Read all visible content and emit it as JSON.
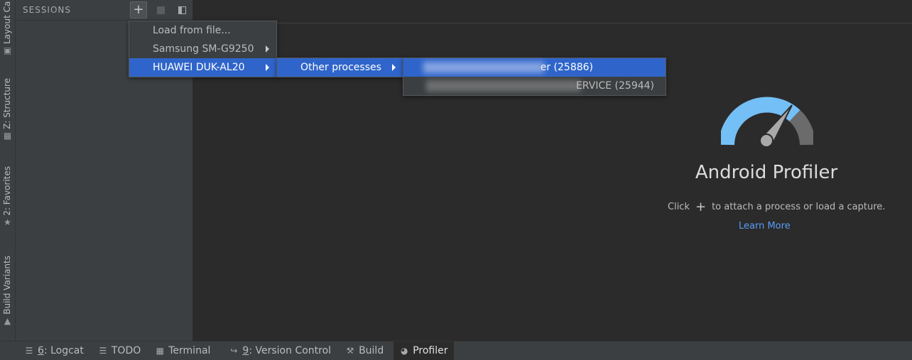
{
  "left_strip": {
    "tabs": [
      {
        "label": "Layout Ca",
        "icon": "layout-captures-icon"
      },
      {
        "label": "Z: Structure",
        "icon": "structure-icon"
      },
      {
        "label": "2: Favorites",
        "icon": "star-icon"
      },
      {
        "label": "Build Variants",
        "icon": "android-icon"
      }
    ]
  },
  "sessions": {
    "title": "SESSIONS",
    "add_icon": "+"
  },
  "menus": {
    "level1": [
      {
        "label": "Load from file...",
        "submenu": false
      },
      {
        "label": "Samsung SM-G9250",
        "submenu": true
      },
      {
        "label": "HUAWEI DUK-AL20",
        "submenu": true,
        "selected": true
      }
    ],
    "level2": [
      {
        "label": "Other processes",
        "submenu": true,
        "selected": true
      }
    ],
    "level3": [
      {
        "label": "er (25886)",
        "selected": true
      },
      {
        "label": "ERVICE (25944)",
        "selected": false
      }
    ]
  },
  "profiler": {
    "title": "Android Profiler",
    "hint_before": "Click",
    "hint_plus": "+",
    "hint_after": "to attach a process or load a capture.",
    "learn_more": "Learn More",
    "colors": {
      "gauge_blue": "#74bff5",
      "gauge_grey": "#6b6b6b",
      "link": "#589df6"
    }
  },
  "bottom_bar": {
    "tabs": [
      {
        "mnemonic": "6",
        "label": ": Logcat",
        "icon": "logcat-icon"
      },
      {
        "mnemonic": "",
        "label": "TODO",
        "icon": "todo-icon"
      },
      {
        "mnemonic": "",
        "label": "Terminal",
        "icon": "terminal-icon"
      },
      {
        "mnemonic": "9",
        "label": ": Version Control",
        "icon": "version-control-icon"
      },
      {
        "mnemonic": "",
        "label": "Build",
        "icon": "build-hammer-icon"
      },
      {
        "mnemonic": "",
        "label": "Profiler",
        "icon": "profiler-gauge-icon",
        "active": true
      }
    ]
  }
}
